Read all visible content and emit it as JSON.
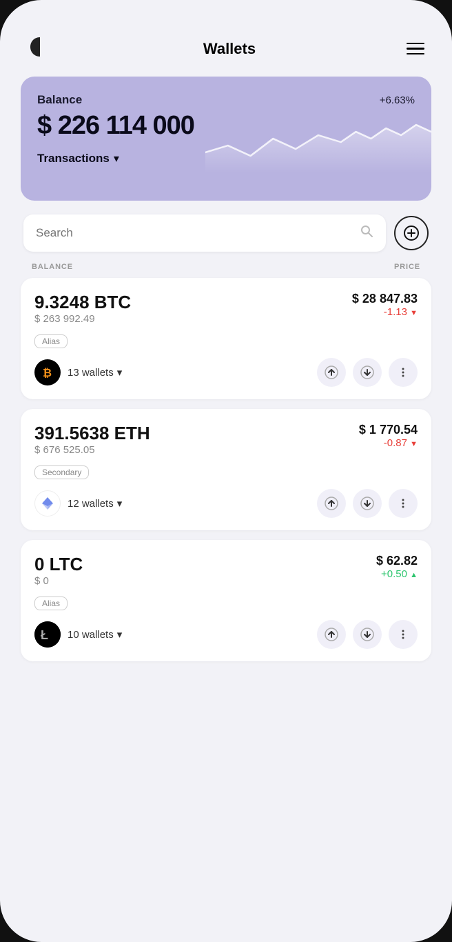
{
  "header": {
    "title": "Wallets",
    "menu_label": "menu"
  },
  "balance_card": {
    "label": "Balance",
    "percent": "+6.63%",
    "amount": "$ 226 114 000",
    "transactions_label": "Transactions"
  },
  "search": {
    "placeholder": "Search",
    "add_label": "+"
  },
  "columns": {
    "balance": "BALANCE",
    "price": "PRICE"
  },
  "coins": [
    {
      "balance": "9.3248 BTC",
      "usd_value": "$ 263 992.49",
      "alias": "Alias",
      "wallets": "13 wallets",
      "price": "$ 28 847.83",
      "change": "-1.13",
      "change_direction": "negative",
      "symbol": "BTC",
      "logo_type": "btc"
    },
    {
      "balance": "391.5638 ETH",
      "usd_value": "$ 676 525.05",
      "alias": "Secondary",
      "wallets": "12 wallets",
      "price": "$ 1 770.54",
      "change": "-0.87",
      "change_direction": "negative",
      "symbol": "ETH",
      "logo_type": "eth"
    },
    {
      "balance": "0 LTC",
      "usd_value": "$ 0",
      "alias": "Alias",
      "wallets": "10 wallets",
      "price": "$ 62.82",
      "change": "+0.50",
      "change_direction": "positive",
      "symbol": "LTC",
      "logo_type": "ltc"
    }
  ]
}
